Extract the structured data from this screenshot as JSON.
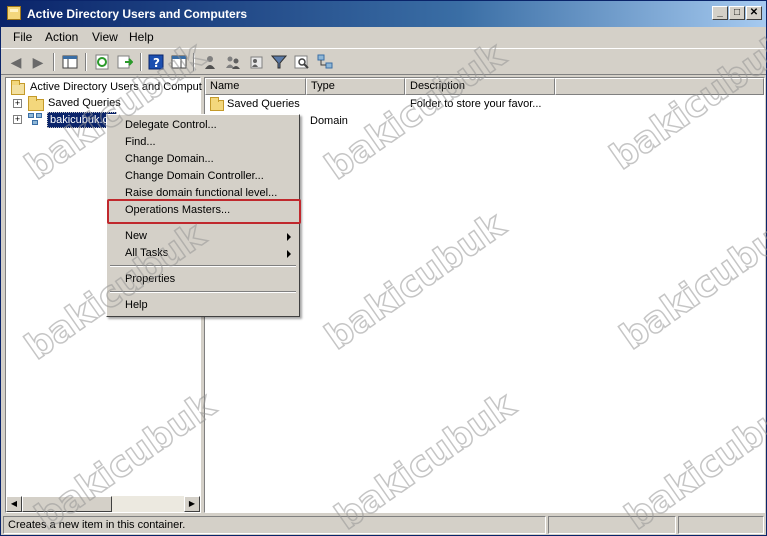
{
  "window": {
    "title": "Active Directory Users and Computers"
  },
  "title_buttons": {
    "minimize": "_",
    "maximize": "□",
    "close": "✕"
  },
  "menubar": [
    "File",
    "Action",
    "View",
    "Help"
  ],
  "toolbar_icons": [
    "back-arrow-icon",
    "forward-arrow-icon",
    "console-tree-icon",
    "refresh-icon",
    "export-list-icon",
    "help-icon",
    "properties-pane-icon",
    "users-icon",
    "group-icon",
    "add-to-group-icon",
    "filter-icon",
    "find-icon",
    "domain-tree-icon"
  ],
  "tree": {
    "root": "Active Directory Users and Comput",
    "items": [
      {
        "label": "Saved Queries",
        "icon": "folder-icon"
      },
      {
        "label": "bakicubuk.co",
        "icon": "domain-icon",
        "selected": true
      }
    ]
  },
  "list": {
    "columns": [
      "Name",
      "Type",
      "Description"
    ],
    "rows": [
      {
        "name": "Saved Queries",
        "type": "",
        "description": "Folder to store your favor..."
      },
      {
        "name": "",
        "type": "Domain",
        "description": ""
      }
    ]
  },
  "context_menu": {
    "items": [
      "Delegate Control...",
      "Find...",
      "Change Domain...",
      "Change Domain Controller...",
      "Raise domain functional level...",
      "Operations Masters...",
      "New",
      "All Tasks",
      "Properties",
      "Help"
    ],
    "highlighted": "Operations Masters...",
    "highlight_color": "#c0282d"
  },
  "statusbar": {
    "text": "Creates a new item in this container."
  },
  "watermark": "bakicubuk",
  "colors": {
    "title_bar": "#0a246a",
    "selection": "#0a246a",
    "chrome": "#d4d0c8"
  }
}
